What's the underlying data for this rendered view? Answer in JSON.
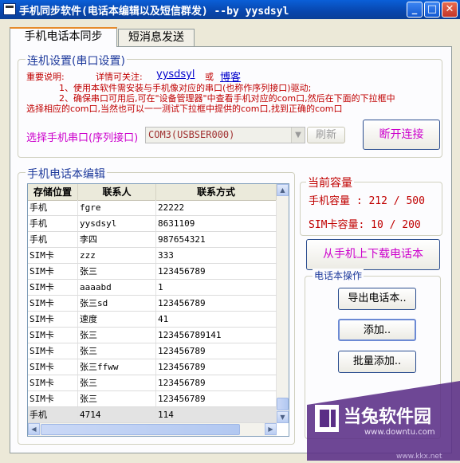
{
  "window": {
    "title": "手机同步软件(电话本编辑以及短信群发) --by yysdsyl",
    "min": "_",
    "max": "□",
    "close": "✕"
  },
  "tabs": [
    {
      "label": "手机电话本同步",
      "active": true
    },
    {
      "label": "短消息发送",
      "active": false
    }
  ],
  "connection": {
    "group_title": "连机设置(串口设置)",
    "note_label": "重要说明:",
    "follow_text": "详情可关注:",
    "link1": "yysdsyl",
    "or": "或",
    "link2": "博客",
    "line1": "1、使用本软件需安装与手机像对应的串口(也称作序列接口)驱动;",
    "line2": "2、确保串口可用后,可在\"设备管理器\"中查看手机对应的com口,然后在下面的下拉框中",
    "line3": "选择相应的com口,当然也可以一一测试下拉框中提供的com口,找到正确的com口",
    "port_label": "选择手机串口(序列接口)",
    "port_value": "COM3(USBSER000)",
    "refresh": "刷新",
    "disconnect": "断开连接"
  },
  "phonebook": {
    "group_title": "手机电话本编辑",
    "columns": [
      "存储位置",
      "联系人",
      "联系方式"
    ],
    "rows": [
      [
        "手机",
        "fgre",
        "22222"
      ],
      [
        "手机",
        "yysdsyl",
        "8631109"
      ],
      [
        "手机",
        "李四",
        "987654321"
      ],
      [
        "SIM卡",
        "zzz",
        "333"
      ],
      [
        "SIM卡",
        "张三",
        "123456789"
      ],
      [
        "SIM卡",
        "aaaabd",
        "1"
      ],
      [
        "SIM卡",
        "张三sd",
        "123456789"
      ],
      [
        "SIM卡",
        "速度",
        "41"
      ],
      [
        "SIM卡",
        "张三",
        "123456789141"
      ],
      [
        "SIM卡",
        "张三",
        "123456789"
      ],
      [
        "SIM卡",
        "张三ffww",
        "123456789"
      ],
      [
        "SIM卡",
        "张三",
        "123456789"
      ],
      [
        "SIM卡",
        "张三",
        "123456789"
      ],
      [
        "手机",
        "4714",
        "114"
      ]
    ]
  },
  "capacity": {
    "group_title": "当前容量",
    "phone": "手机容量 : 212 / 500",
    "sim": "SIM卡容量: 10 / 200"
  },
  "download_button": "从手机上下载电话本",
  "operations": {
    "group_title": "电话本操作",
    "export": "导出电话本..",
    "add": "添加..",
    "batch_add": "批量添加.."
  },
  "watermark": {
    "brand": "当兔软件园",
    "url": "www.downtu.com",
    "url2": "www.kkx.net"
  }
}
